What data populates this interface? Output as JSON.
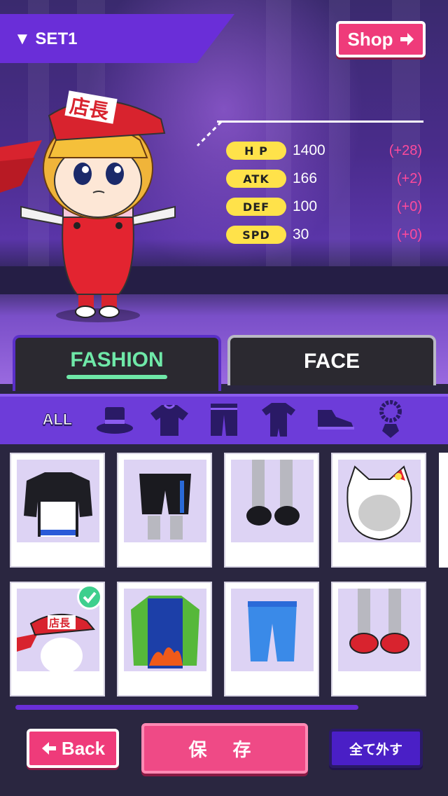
{
  "header": {
    "set_label": "▼ SET1",
    "shop_label": "Shop"
  },
  "stats": [
    {
      "name": "H P",
      "value": "1400",
      "bonus": "(+28)"
    },
    {
      "name": "ATK",
      "value": "166",
      "bonus": "(+2)"
    },
    {
      "name": "DEF",
      "value": "100",
      "bonus": "(+0)"
    },
    {
      "name": "SPD",
      "value": "30",
      "bonus": "(+0)"
    }
  ],
  "avatar": {
    "cap_text": "店長"
  },
  "tabs": {
    "fashion": "FASHION",
    "face": "FACE",
    "selected": "FASHION"
  },
  "categories": {
    "all_label": "ALL",
    "icons": [
      "hat-icon",
      "shirt-icon",
      "pants-icon",
      "outfit-icon",
      "shoes-icon",
      "accessory-icon"
    ]
  },
  "items": [
    {
      "name": "black-hoodie-outfit",
      "equipped": false
    },
    {
      "name": "black-shorts",
      "equipped": false
    },
    {
      "name": "black-shoes",
      "equipped": false
    },
    {
      "name": "hello-kitty-hood",
      "equipped": false
    },
    {
      "name": "tencho-cap",
      "equipped": true,
      "text": "店長"
    },
    {
      "name": "flame-jacket",
      "equipped": false
    },
    {
      "name": "blue-jeans",
      "equipped": false
    },
    {
      "name": "red-sneakers",
      "equipped": false
    }
  ],
  "footer": {
    "back_label": "Back",
    "save_label": "保 存",
    "remove_all_label": "全て外す"
  },
  "colors": {
    "accent": "#6a2ed8",
    "pink": "#ef3b7a",
    "stat_pill": "#ffe24a",
    "bonus": "#ff4a9c",
    "fashion_tab": "#6fe8a8"
  }
}
